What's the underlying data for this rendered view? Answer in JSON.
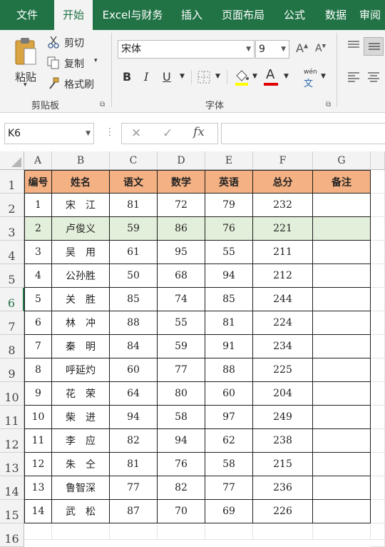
{
  "tabs": [
    "文件",
    "开始",
    "Excel与财务",
    "插入",
    "页面布局",
    "公式",
    "数据",
    "审阅"
  ],
  "ribbon": {
    "paste_label": "粘贴",
    "cut_label": "剪切",
    "copy_label": "复制",
    "format_painter_label": "格式刷",
    "clipboard_group": "剪贴板",
    "font_group": "字体",
    "font_name": "宋体",
    "font_size": "9",
    "bold": "B",
    "italic": "I",
    "underline": "U",
    "font_color_letter": "A",
    "phonetic_top": "wén",
    "phonetic_bottom": "文",
    "font_color_hex": "#e00000"
  },
  "formula_bar": {
    "name_box": "K6",
    "fx": "fx",
    "value": ""
  },
  "columns": [
    "A",
    "B",
    "C",
    "D",
    "E",
    "F",
    "G"
  ],
  "row_numbers": [
    "1",
    "2",
    "3",
    "4",
    "5",
    "6",
    "7",
    "8",
    "9",
    "10",
    "11",
    "12",
    "13",
    "14",
    "15",
    "16"
  ],
  "table": {
    "header": [
      "编号",
      "姓名",
      "语文",
      "数学",
      "英语",
      "总分",
      "备注"
    ],
    "rows": [
      [
        "1",
        "宋　江",
        "81",
        "72",
        "79",
        "232",
        ""
      ],
      [
        "2",
        "卢俊义",
        "59",
        "86",
        "76",
        "221",
        ""
      ],
      [
        "3",
        "吴　用",
        "61",
        "95",
        "55",
        "211",
        ""
      ],
      [
        "4",
        "公孙胜",
        "50",
        "68",
        "94",
        "212",
        ""
      ],
      [
        "5",
        "关　胜",
        "85",
        "74",
        "85",
        "244",
        ""
      ],
      [
        "6",
        "林　冲",
        "88",
        "55",
        "81",
        "224",
        ""
      ],
      [
        "7",
        "秦　明",
        "84",
        "59",
        "91",
        "234",
        ""
      ],
      [
        "8",
        "呼延灼",
        "60",
        "77",
        "88",
        "225",
        ""
      ],
      [
        "9",
        "花　荣",
        "64",
        "80",
        "60",
        "204",
        ""
      ],
      [
        "10",
        "柴　进",
        "94",
        "58",
        "97",
        "249",
        ""
      ],
      [
        "11",
        "李　应",
        "82",
        "94",
        "62",
        "238",
        ""
      ],
      [
        "12",
        "朱　仝",
        "81",
        "76",
        "58",
        "215",
        ""
      ],
      [
        "13",
        "鲁智深",
        "77",
        "82",
        "77",
        "236",
        ""
      ],
      [
        "14",
        "武　松",
        "87",
        "70",
        "69",
        "226",
        ""
      ]
    ]
  },
  "colors": {
    "brand_green": "#217346",
    "header_fill": "#f4b183",
    "highlight_row_fill": "#e2efda"
  }
}
